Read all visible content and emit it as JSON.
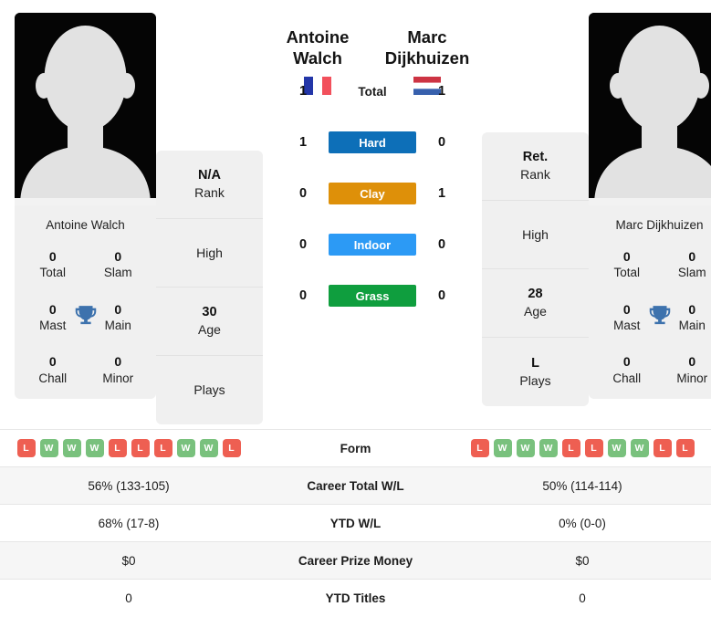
{
  "players": {
    "left": {
      "first_name": "Antoine",
      "last_name": "Walch",
      "full_name": "Antoine Walch",
      "flag": "france-flag-icon",
      "photo": "player-silhouette-avatar",
      "titles": [
        {
          "value": "0",
          "label": "Total"
        },
        {
          "value": "0",
          "label": "Slam"
        },
        {
          "value": "0",
          "label": "Mast"
        },
        {
          "value": "0",
          "label": "Main"
        },
        {
          "value": "0",
          "label": "Chall"
        },
        {
          "value": "0",
          "label": "Minor"
        }
      ],
      "stack": [
        {
          "value": "N/A",
          "label": "Rank"
        },
        {
          "value": "",
          "label": "High"
        },
        {
          "value": "30",
          "label": "Age"
        },
        {
          "value": "",
          "label": "Plays"
        }
      ],
      "form": [
        "L",
        "W",
        "W",
        "W",
        "L",
        "L",
        "L",
        "W",
        "W",
        "L"
      ],
      "career_total_wl": "56% (133-105)",
      "ytd_wl": "68% (17-8)",
      "career_prize_money": "$0",
      "ytd_titles": "0"
    },
    "right": {
      "first_name": "Marc",
      "last_name": "Dijkhuizen",
      "full_name": "Marc Dijkhuizen",
      "flag": "netherlands-flag-icon",
      "photo": "player-silhouette-avatar",
      "titles": [
        {
          "value": "0",
          "label": "Total"
        },
        {
          "value": "0",
          "label": "Slam"
        },
        {
          "value": "0",
          "label": "Mast"
        },
        {
          "value": "0",
          "label": "Main"
        },
        {
          "value": "0",
          "label": "Chall"
        },
        {
          "value": "0",
          "label": "Minor"
        }
      ],
      "stack": [
        {
          "value": "Ret.",
          "label": "Rank"
        },
        {
          "value": "",
          "label": "High"
        },
        {
          "value": "28",
          "label": "Age"
        },
        {
          "value": "L",
          "label": "Plays"
        }
      ],
      "form": [
        "L",
        "W",
        "W",
        "W",
        "L",
        "L",
        "W",
        "W",
        "L",
        "L"
      ],
      "career_total_wl": "50% (114-114)",
      "ytd_wl": "0% (0-0)",
      "career_prize_money": "$0",
      "ytd_titles": "0"
    }
  },
  "head_to_head": [
    {
      "surface": "Total",
      "left": "1",
      "right": "1",
      "color": ""
    },
    {
      "surface": "Hard",
      "left": "1",
      "right": "0",
      "color": "#0d6fb8"
    },
    {
      "surface": "Clay",
      "left": "0",
      "right": "1",
      "color": "#de9009"
    },
    {
      "surface": "Indoor",
      "left": "0",
      "right": "0",
      "color": "#2c9af5"
    },
    {
      "surface": "Grass",
      "left": "0",
      "right": "0",
      "color": "#0f9e3e"
    }
  ],
  "stats_table": [
    {
      "label": "Form",
      "left": "",
      "right": ""
    },
    {
      "label": "Career Total W/L",
      "left": "56% (133-105)",
      "right": "50% (114-114)"
    },
    {
      "label": "YTD W/L",
      "left": "68% (17-8)",
      "right": "0% (0-0)"
    },
    {
      "label": "Career Prize Money",
      "left": "$0",
      "right": "$0"
    },
    {
      "label": "YTD Titles",
      "left": "0",
      "right": "0"
    }
  ],
  "colors": {
    "win_badge": "#79c17d",
    "loss_badge": "#ee5f52",
    "trophy": "#3d72ad",
    "card_bg": "#f0f0f0",
    "row_alt": "#f6f6f6"
  },
  "icons": {
    "trophy": "trophy-icon"
  }
}
